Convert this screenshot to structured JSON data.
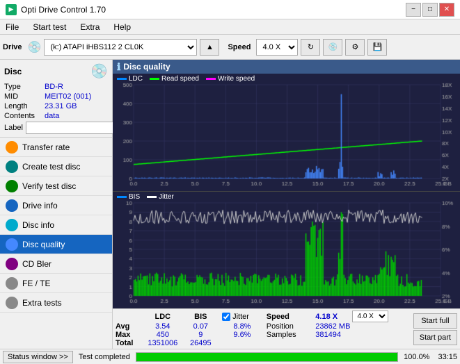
{
  "window": {
    "title": "Opti Drive Control 1.70",
    "icon": "ODC"
  },
  "titlebar": {
    "minimize": "−",
    "maximize": "□",
    "close": "✕"
  },
  "menubar": {
    "items": [
      "File",
      "Start test",
      "Extra",
      "Help"
    ]
  },
  "toolbar": {
    "drive_label": "Drive",
    "drive_value": "(k:) ATAPI iHBS112  2 CL0K",
    "speed_label": "Speed",
    "speed_value": "4.0 X"
  },
  "disc": {
    "section_title": "Disc",
    "type_label": "Type",
    "type_value": "BD-R",
    "mid_label": "MID",
    "mid_value": "MEIT02 (001)",
    "length_label": "Length",
    "length_value": "23.31 GB",
    "contents_label": "Contents",
    "contents_value": "data",
    "label_label": "Label",
    "label_value": ""
  },
  "nav": {
    "items": [
      {
        "id": "transfer-rate",
        "label": "Transfer rate",
        "icon": "orange"
      },
      {
        "id": "create-test-disc",
        "label": "Create test disc",
        "icon": "teal"
      },
      {
        "id": "verify-test-disc",
        "label": "Verify test disc",
        "icon": "green"
      },
      {
        "id": "drive-info",
        "label": "Drive info",
        "icon": "blue"
      },
      {
        "id": "disc-info",
        "label": "Disc info",
        "icon": "cyan"
      },
      {
        "id": "disc-quality",
        "label": "Disc quality",
        "icon": "blue",
        "active": true
      },
      {
        "id": "cd-bler",
        "label": "CD Bler",
        "icon": "purple"
      },
      {
        "id": "fe-te",
        "label": "FE / TE",
        "icon": "gray"
      },
      {
        "id": "extra-tests",
        "label": "Extra tests",
        "icon": "gray"
      }
    ]
  },
  "chart": {
    "title": "Disc quality",
    "legend_upper": [
      {
        "label": "LDC",
        "color": "#0088ff"
      },
      {
        "label": "Read speed",
        "color": "#00ff00"
      },
      {
        "label": "Write speed",
        "color": "#ff00ff"
      }
    ],
    "legend_lower": [
      {
        "label": "BIS",
        "color": "#0088ff"
      },
      {
        "label": "Jitter",
        "color": "#ffffff"
      }
    ],
    "upper_y_max": 500,
    "upper_y_right_max": 18,
    "lower_y_max": 10,
    "lower_y_right_max": 10,
    "x_max": 25,
    "x_axis_labels": [
      "0.0",
      "2.5",
      "5.0",
      "7.5",
      "10.0",
      "12.5",
      "15.0",
      "17.5",
      "20.0",
      "22.5",
      "25.0"
    ],
    "right_y_labels_upper": [
      "18X",
      "16X",
      "14X",
      "12X",
      "10X",
      "8X",
      "6X",
      "4X",
      "2X"
    ],
    "right_y_labels_lower": [
      "10%",
      "8%",
      "6%",
      "4%",
      "2%"
    ]
  },
  "stats": {
    "columns": [
      "",
      "LDC",
      "BIS",
      "",
      "Jitter",
      "Speed",
      "4.18 X",
      "",
      "4.0 X"
    ],
    "avg_label": "Avg",
    "avg_ldc": "3.54",
    "avg_bis": "0.07",
    "avg_jitter": "8.8%",
    "max_label": "Max",
    "max_ldc": "450",
    "max_bis": "9",
    "max_jitter": "9.6%",
    "total_label": "Total",
    "total_ldc": "1351006",
    "total_bis": "26495",
    "position_label": "Position",
    "position_value": "23862 MB",
    "samples_label": "Samples",
    "samples_value": "381494",
    "speed_display": "4.18 X",
    "speed_select": "4.0 X"
  },
  "buttons": {
    "start_full": "Start full",
    "start_part": "Start part"
  },
  "statusbar": {
    "status_btn": "Status window >>",
    "progress": 100,
    "status_text": "Test completed",
    "time": "33:15"
  }
}
